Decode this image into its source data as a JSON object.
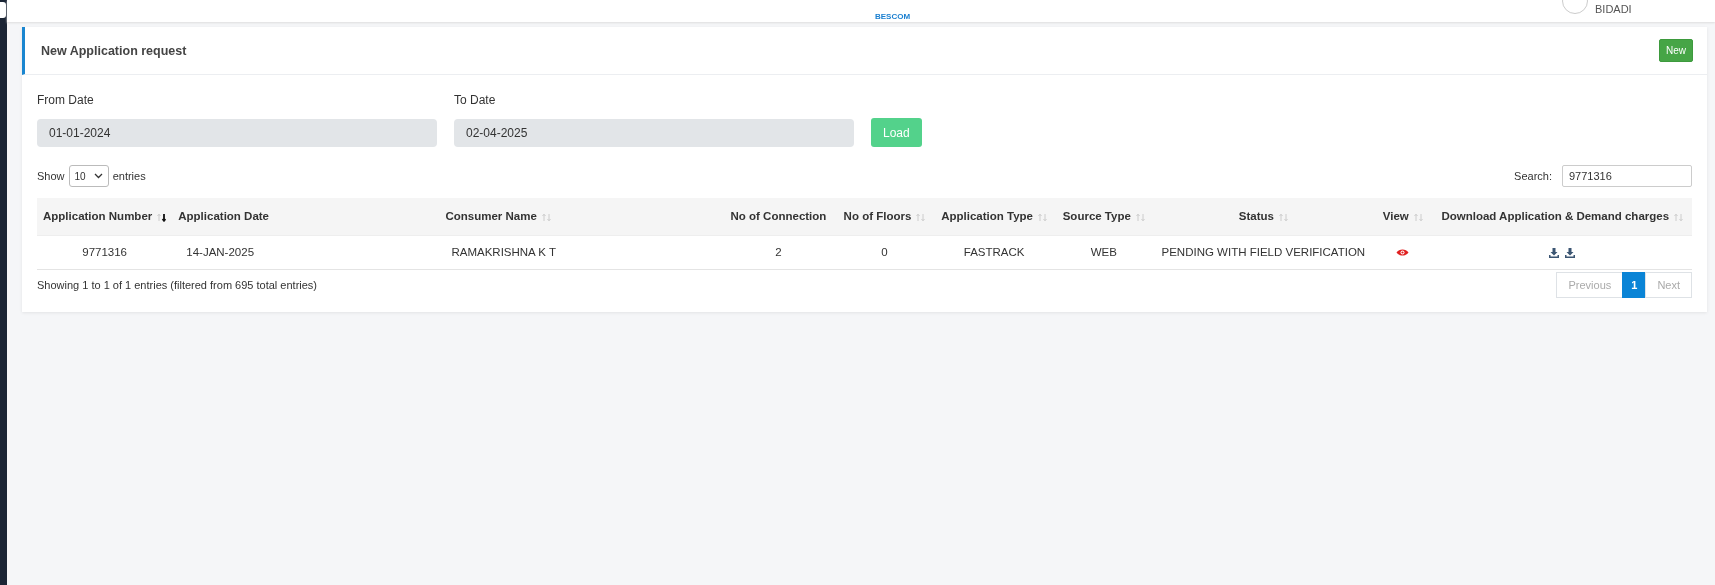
{
  "topbar": {
    "logo_text": "BESCOM",
    "user_location": "BIDADI"
  },
  "card": {
    "title": "New Application request",
    "new_button": "New"
  },
  "filters": {
    "from": {
      "label": "From Date",
      "value": "01-01-2024"
    },
    "to": {
      "label": "To Date",
      "value": "02-04-2025"
    },
    "load_button": "Load"
  },
  "length": {
    "prefix": "Show",
    "value": "10",
    "suffix": "entries"
  },
  "search": {
    "label": "Search:",
    "value": "9771316"
  },
  "table": {
    "columns": [
      {
        "label": "Application Number",
        "sortable": true,
        "sorted": true
      },
      {
        "label": "Application Date",
        "sortable": false
      },
      {
        "label": "Consumer Name",
        "sortable": true,
        "sorted": false
      },
      {
        "label": "No of Connection",
        "sortable": false
      },
      {
        "label": "No of Floors",
        "sortable": true,
        "sorted": false
      },
      {
        "label": "Application Type",
        "sortable": true,
        "sorted": false
      },
      {
        "label": "Source Type",
        "sortable": true,
        "sorted": false
      },
      {
        "label": "Status",
        "sortable": true,
        "sorted": false
      },
      {
        "label": "View",
        "sortable": true,
        "sorted": false
      },
      {
        "label": "Download Application & Demand charges",
        "sortable": true,
        "sorted": false
      }
    ],
    "rows": [
      {
        "cells": [
          "9771316",
          "14-JAN-2025",
          "RAMAKRISHNA K T",
          "2",
          "0",
          "FASTRACK",
          "WEB",
          "PENDING WITH FIELD VERIFICATION"
        ],
        "view": true
      }
    ]
  },
  "info": "Showing 1 to 1 of 1 entries (filtered from 695 total entries)",
  "pagination": [
    {
      "label": "Previous",
      "kind": "nav",
      "disabled": true,
      "selected": false
    },
    {
      "label": "1",
      "kind": "page",
      "disabled": false,
      "selected": true
    },
    {
      "label": "Next",
      "kind": "nav",
      "disabled": true,
      "selected": false
    }
  ]
}
